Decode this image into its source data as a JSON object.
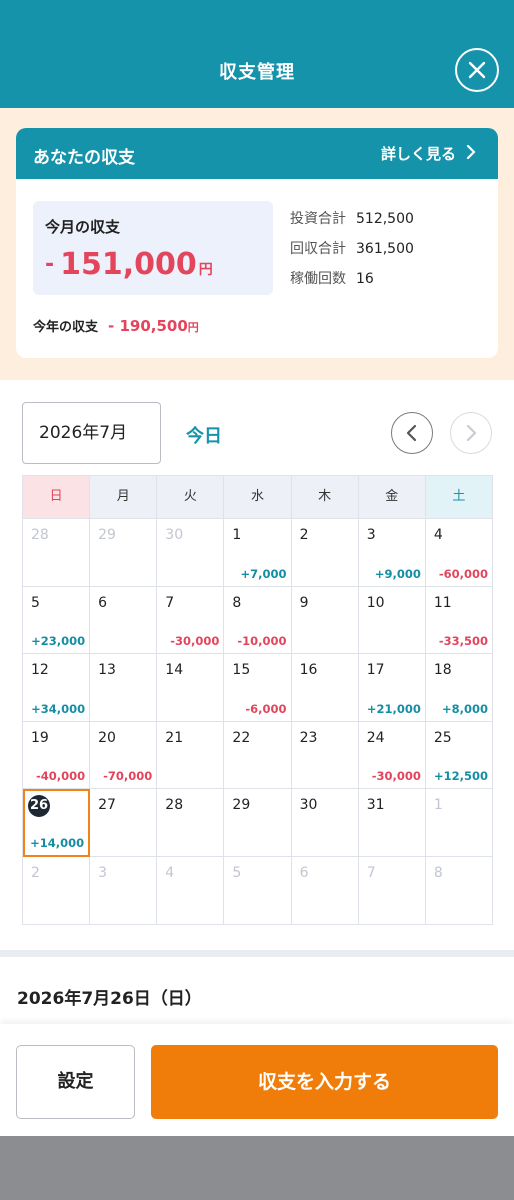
{
  "header": {
    "title": "収支管理"
  },
  "summary": {
    "card_title": "あなたの収支",
    "more_label": "詳しく見る",
    "month_label": "今月の収支",
    "month_sign": "-",
    "month_value": "151,000",
    "yen": "円",
    "stats": [
      {
        "label": "投資合計",
        "value": "512,500"
      },
      {
        "label": "回収合計",
        "value": "361,500"
      },
      {
        "label": "稼働回数",
        "value": "16"
      }
    ],
    "year_label": "今年の収支",
    "year_value": "- 190,500"
  },
  "calendar": {
    "month_select": "2026年7月",
    "today_label": "今日",
    "weekdays": [
      "日",
      "月",
      "火",
      "水",
      "木",
      "金",
      "土"
    ],
    "weeks": [
      [
        {
          "day": "28",
          "other": true
        },
        {
          "day": "29",
          "other": true
        },
        {
          "day": "30",
          "other": true
        },
        {
          "day": "1",
          "amount": "+7,000"
        },
        {
          "day": "2"
        },
        {
          "day": "3",
          "amount": "+9,000"
        },
        {
          "day": "4",
          "amount": "-60,000"
        }
      ],
      [
        {
          "day": "5",
          "amount": "+23,000"
        },
        {
          "day": "6"
        },
        {
          "day": "7",
          "amount": "-30,000"
        },
        {
          "day": "8",
          "amount": "-10,000"
        },
        {
          "day": "9"
        },
        {
          "day": "10"
        },
        {
          "day": "11",
          "amount": "-33,500"
        }
      ],
      [
        {
          "day": "12",
          "amount": "+34,000"
        },
        {
          "day": "13"
        },
        {
          "day": "14"
        },
        {
          "day": "15",
          "amount": "-6,000"
        },
        {
          "day": "16"
        },
        {
          "day": "17",
          "amount": "+21,000"
        },
        {
          "day": "18",
          "amount": "+8,000"
        }
      ],
      [
        {
          "day": "19",
          "amount": "-40,000"
        },
        {
          "day": "20",
          "amount": "-70,000"
        },
        {
          "day": "21"
        },
        {
          "day": "22"
        },
        {
          "day": "23"
        },
        {
          "day": "24",
          "amount": "-30,000"
        },
        {
          "day": "25",
          "amount": "+12,500"
        }
      ],
      [
        {
          "day": "26",
          "amount": "+14,000",
          "today": true
        },
        {
          "day": "27"
        },
        {
          "day": "28"
        },
        {
          "day": "29"
        },
        {
          "day": "30"
        },
        {
          "day": "31"
        },
        {
          "day": "1",
          "other": true
        }
      ],
      [
        {
          "day": "2",
          "other": true
        },
        {
          "day": "3",
          "other": true
        },
        {
          "day": "4",
          "other": true
        },
        {
          "day": "5",
          "other": true
        },
        {
          "day": "6",
          "other": true
        },
        {
          "day": "7",
          "other": true
        },
        {
          "day": "8",
          "other": true
        }
      ]
    ]
  },
  "selected_date": "2026年7月26日（日）",
  "footer": {
    "settings_label": "設定",
    "input_label": "収支を入力する"
  },
  "colors": {
    "teal": "#1593ab",
    "orange": "#f07d0a",
    "negative": "#e2455c",
    "positive": "#158ea4"
  }
}
